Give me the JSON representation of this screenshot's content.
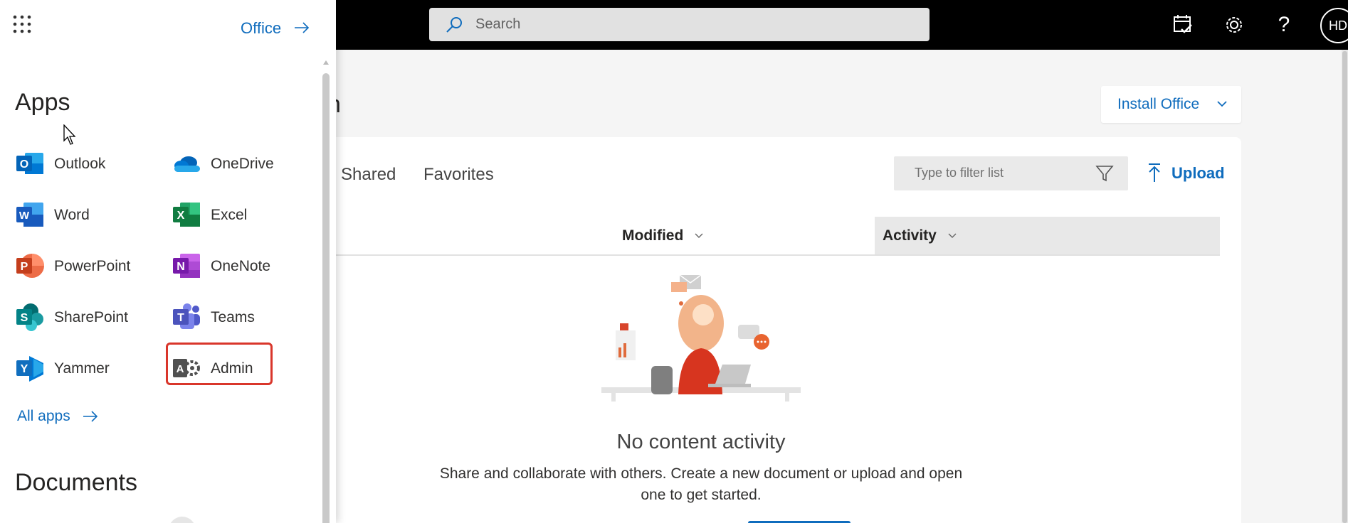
{
  "topbar": {
    "search_placeholder": "Search",
    "avatar_initials": "HD",
    "help_glyph": "?",
    "icons": [
      "search-icon",
      "my-day-icon",
      "settings-gear-icon",
      "help-icon"
    ]
  },
  "main": {
    "heading_fragment": "n",
    "install_office_label": "Install Office",
    "tabs": [
      {
        "label": "Shared"
      },
      {
        "label": "Favorites"
      }
    ],
    "filter_placeholder": "Type to filter list",
    "upload_label": "Upload",
    "columns": [
      {
        "label": "Modified"
      },
      {
        "label": "Activity"
      }
    ],
    "empty_state": {
      "title": "No content activity",
      "description_line1": "Share and collaborate with others. Create a new document or upload and open",
      "description_line2": "one to get started."
    }
  },
  "launcher": {
    "office_link_label": "Office",
    "apps_title": "Apps",
    "apps": [
      {
        "name": "Outlook",
        "icon": "outlook-icon",
        "color": "#0364b8",
        "letter": "O"
      },
      {
        "name": "OneDrive",
        "icon": "onedrive-icon",
        "color": "#0f78d4",
        "letter": ""
      },
      {
        "name": "Word",
        "icon": "word-icon",
        "color": "#185abd",
        "letter": "W"
      },
      {
        "name": "Excel",
        "icon": "excel-icon",
        "color": "#107c41",
        "letter": "X"
      },
      {
        "name": "PowerPoint",
        "icon": "powerpoint-icon",
        "color": "#c43e1c",
        "letter": "P"
      },
      {
        "name": "OneNote",
        "icon": "onenote-icon",
        "color": "#7719aa",
        "letter": "N"
      },
      {
        "name": "SharePoint",
        "icon": "sharepoint-icon",
        "color": "#038387",
        "letter": "S"
      },
      {
        "name": "Teams",
        "icon": "teams-icon",
        "color": "#5059c9",
        "letter": "T"
      },
      {
        "name": "Yammer",
        "icon": "yammer-icon",
        "color": "#106ebe",
        "letter": "Y"
      },
      {
        "name": "Admin",
        "icon": "admin-icon",
        "color": "#505050",
        "letter": "A"
      }
    ],
    "all_apps_label": "All apps",
    "documents_title": "Documents"
  },
  "colors": {
    "accent": "#0f6cbd",
    "highlight_box": "#d9362b",
    "topbar": "#000000"
  }
}
